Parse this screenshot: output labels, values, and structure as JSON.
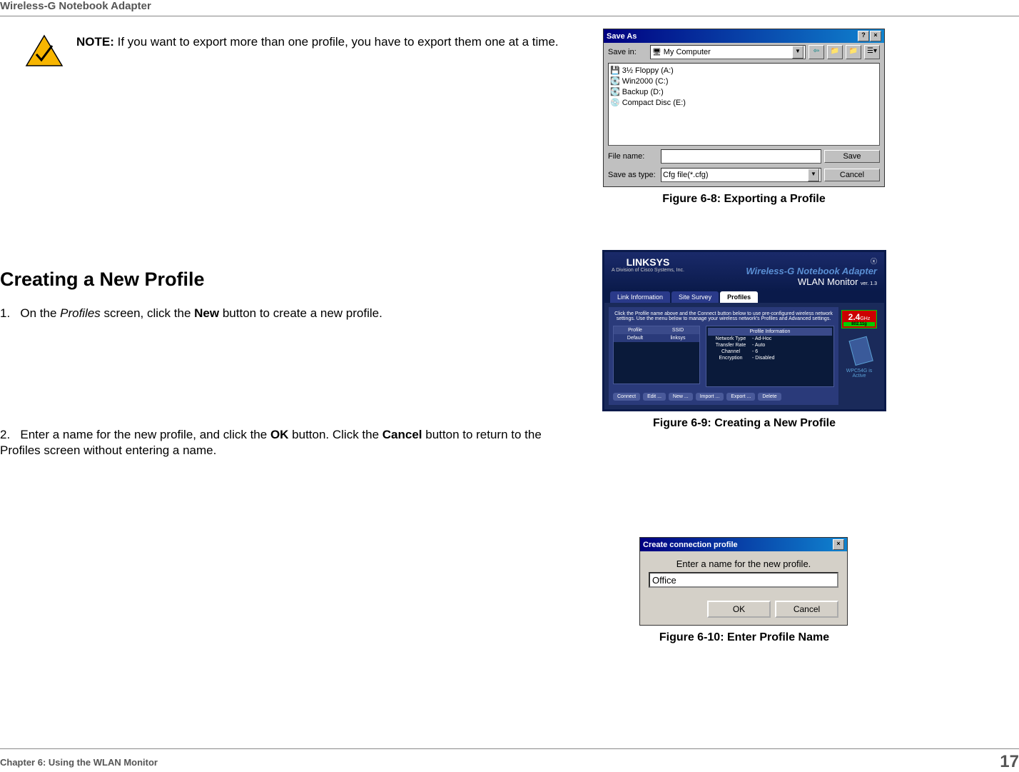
{
  "header": {
    "title": "Wireless-G Notebook Adapter"
  },
  "footer": {
    "chapter": "Chapter 6: Using the WLAN Monitor",
    "page_number": "17"
  },
  "note": {
    "label": "NOTE:",
    "text": "If you want to export more than one profile, you have to export them one at a time."
  },
  "section_heading": "Creating a New Profile",
  "step1": {
    "num": "1.",
    "pre": "On the ",
    "italic1": "Profiles",
    "mid1": " screen, click the ",
    "bold1": "New",
    "post": " button to create a new profile."
  },
  "step2": {
    "num": "2.",
    "pre": "Enter a name for the new profile, and click the ",
    "bold1": "OK",
    "mid1": " button. Click the ",
    "bold2": "Cancel",
    "post": " button to return to the Profiles screen without entering a name."
  },
  "figure_68": {
    "caption": "Figure 6-8: Exporting a Profile",
    "dialog_title": "Save As",
    "savein_label": "Save in:",
    "savein_value": "My Computer",
    "items": [
      "3½ Floppy (A:)",
      "Win2000 (C:)",
      "Backup (D:)",
      "Compact Disc (E:)"
    ],
    "filename_label": "File name:",
    "filetype_label": "Save as type:",
    "filetype_value": "Cfg file(*.cfg)",
    "save_btn": "Save",
    "cancel_btn": "Cancel"
  },
  "figure_69": {
    "caption": "Figure 6-9: Creating a New Profile",
    "logo": "LINKSYS",
    "logo_sub": "A Division of Cisco Systems, Inc.",
    "title1": "Wireless-G Notebook Adapter",
    "title2": "WLAN Monitor",
    "version": "ver. 1.3",
    "tab1": "Link Information",
    "tab2": "Site Survey",
    "tab3": "Profiles",
    "instruction": "Click the Profile name above and the Connect button below to use pre-configured wireless network settings. Use the menu below to manage your wireless network's Profiles and Advanced settings.",
    "header_profile": "Profile",
    "header_ssid": "SSID",
    "row_profile": "Default",
    "row_ssid": "linksys",
    "info_header": "Profile Information",
    "info_rows": [
      [
        "Network Type",
        "- Ad-Hoc"
      ],
      [
        "Transfer Rate",
        "- Auto"
      ],
      [
        "Channel",
        "- 6"
      ],
      [
        "Encryption",
        "- Disabled"
      ]
    ],
    "btn_connect": "Connect",
    "btn_edit": "Edit ...",
    "btn_new": "New ...",
    "btn_import": "Import ...",
    "btn_export": "Export ...",
    "btn_delete": "Delete",
    "ghz": "2.4",
    "ghz_label": "GHz",
    "standard": "802.11g",
    "status": "WPC54G is Active"
  },
  "figure_610": {
    "caption": "Figure 6-10: Enter Profile Name",
    "dialog_title": "Create connection profile",
    "prompt": "Enter a name for the new profile.",
    "input_value": "Office",
    "ok_btn": "OK",
    "cancel_btn": "Cancel"
  }
}
